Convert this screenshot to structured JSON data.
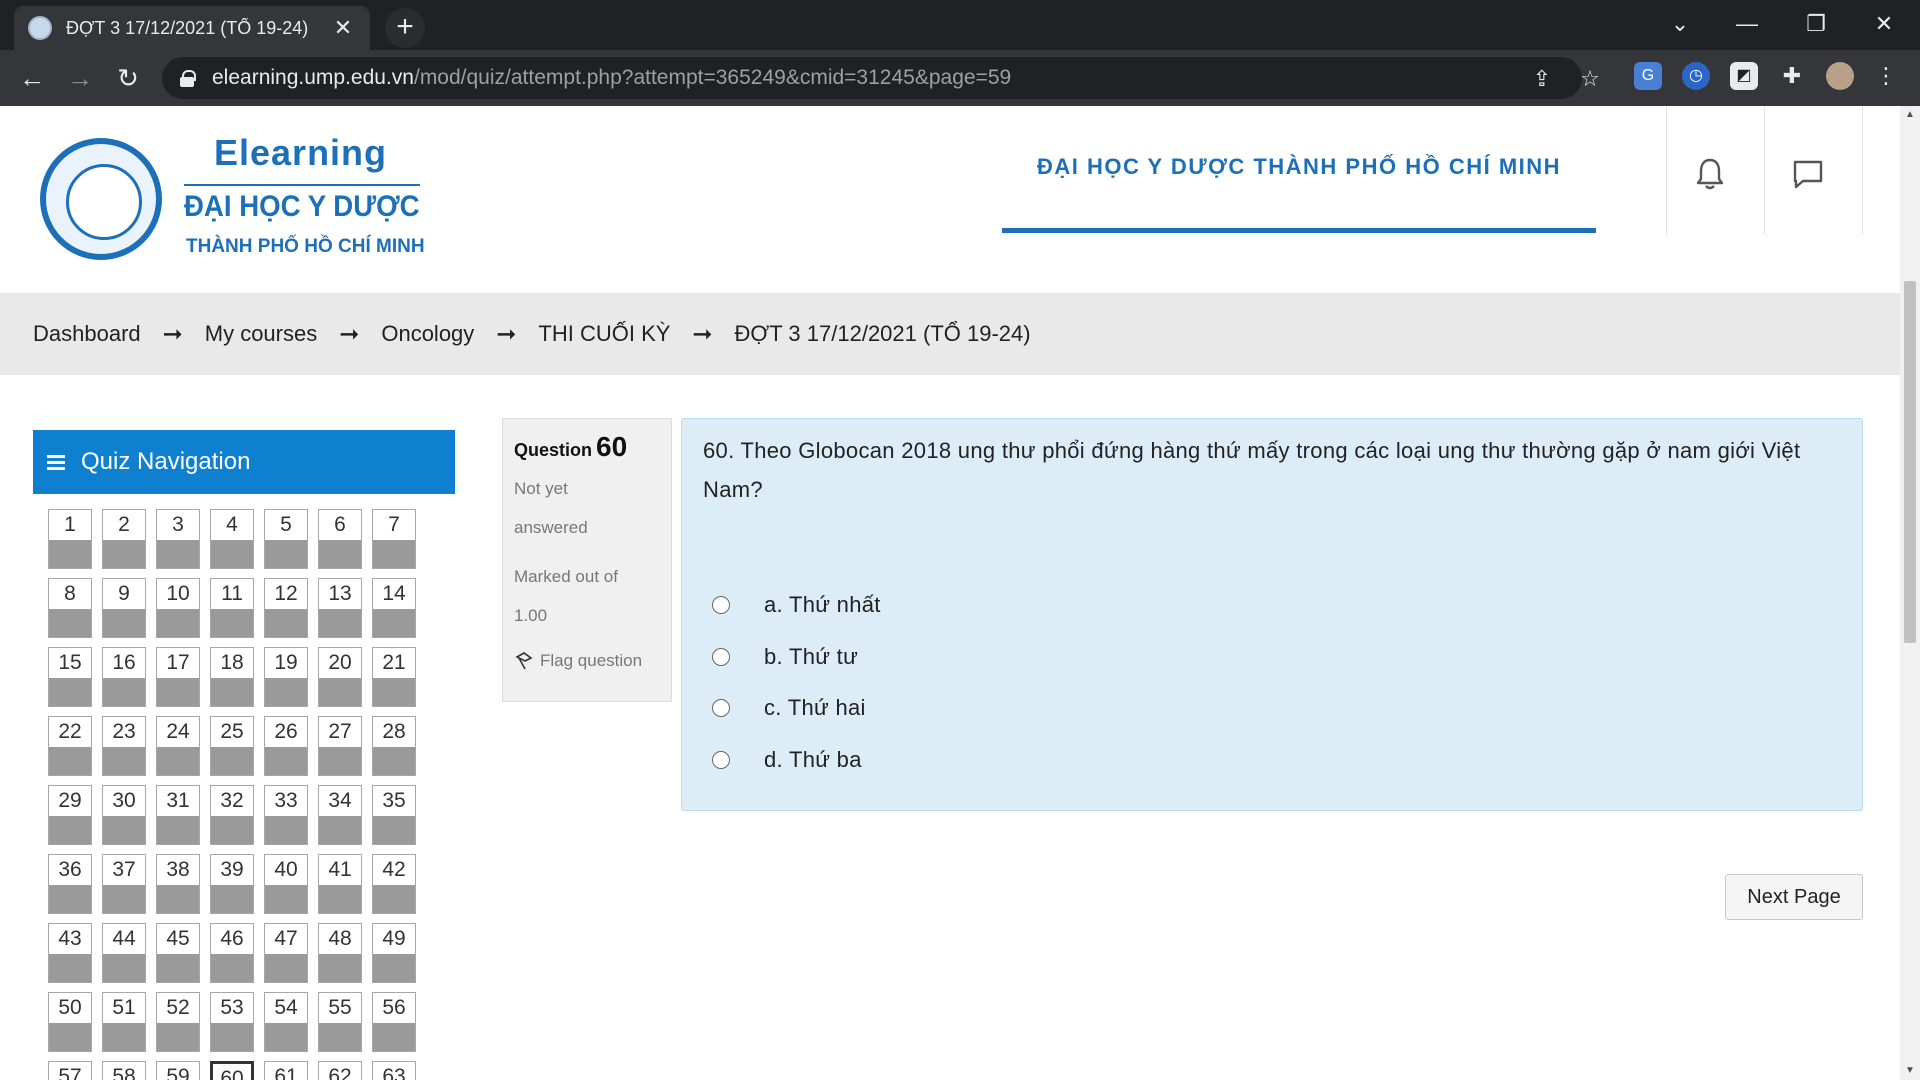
{
  "browser": {
    "tab_title": "ĐỢT 3 17/12/2021 (TỔ 19-24)",
    "url_host": "elearning.ump.edu.vn",
    "url_path": "/mod/quiz/attempt.php?attempt=365249&cmid=31245&page=59"
  },
  "header": {
    "logo_title": "Elearning",
    "logo_line1": "ĐẠI HỌC Y DƯỢC",
    "logo_line2": "THÀNH PHỐ HỒ CHÍ MINH",
    "site_name": "ĐẠI HỌC Y DƯỢC THÀNH PHỐ HỒ CHÍ MINH"
  },
  "breadcrumb": [
    "Dashboard",
    "My courses",
    "Oncology",
    "THI CUỐI KỲ",
    "ĐỢT 3 17/12/2021 (TỔ 19-24)"
  ],
  "quiz_nav": {
    "title": "Quiz Navigation",
    "current": 60,
    "questions": [
      "1",
      "2",
      "3",
      "4",
      "5",
      "6",
      "7",
      "8",
      "9",
      "10",
      "11",
      "12",
      "13",
      "14",
      "15",
      "16",
      "17",
      "18",
      "19",
      "20",
      "21",
      "22",
      "23",
      "24",
      "25",
      "26",
      "27",
      "28",
      "29",
      "30",
      "31",
      "32",
      "33",
      "34",
      "35",
      "36",
      "37",
      "38",
      "39",
      "40",
      "41",
      "42",
      "43",
      "44",
      "45",
      "46",
      "47",
      "48",
      "49",
      "50",
      "51",
      "52",
      "53",
      "54",
      "55",
      "56",
      "57",
      "58",
      "59",
      "60",
      "61",
      "62",
      "63"
    ]
  },
  "question_info": {
    "label": "Question",
    "number": "60",
    "state_line1": "Not yet",
    "state_line2": "answered",
    "grade_line1": "Marked out of",
    "grade_line2": "1.00",
    "flag_label": "Flag question"
  },
  "question": {
    "text": "60. Theo Globocan 2018 ung thư phổi đứng hàng thứ mấy trong các loại ung thư thường gặp ở nam giới Việt Nam?",
    "answers": [
      "a. Thứ nhất",
      "b. Thứ tư",
      "c. Thứ hai",
      "d. Thứ ba"
    ]
  },
  "next_button": "Next Page"
}
